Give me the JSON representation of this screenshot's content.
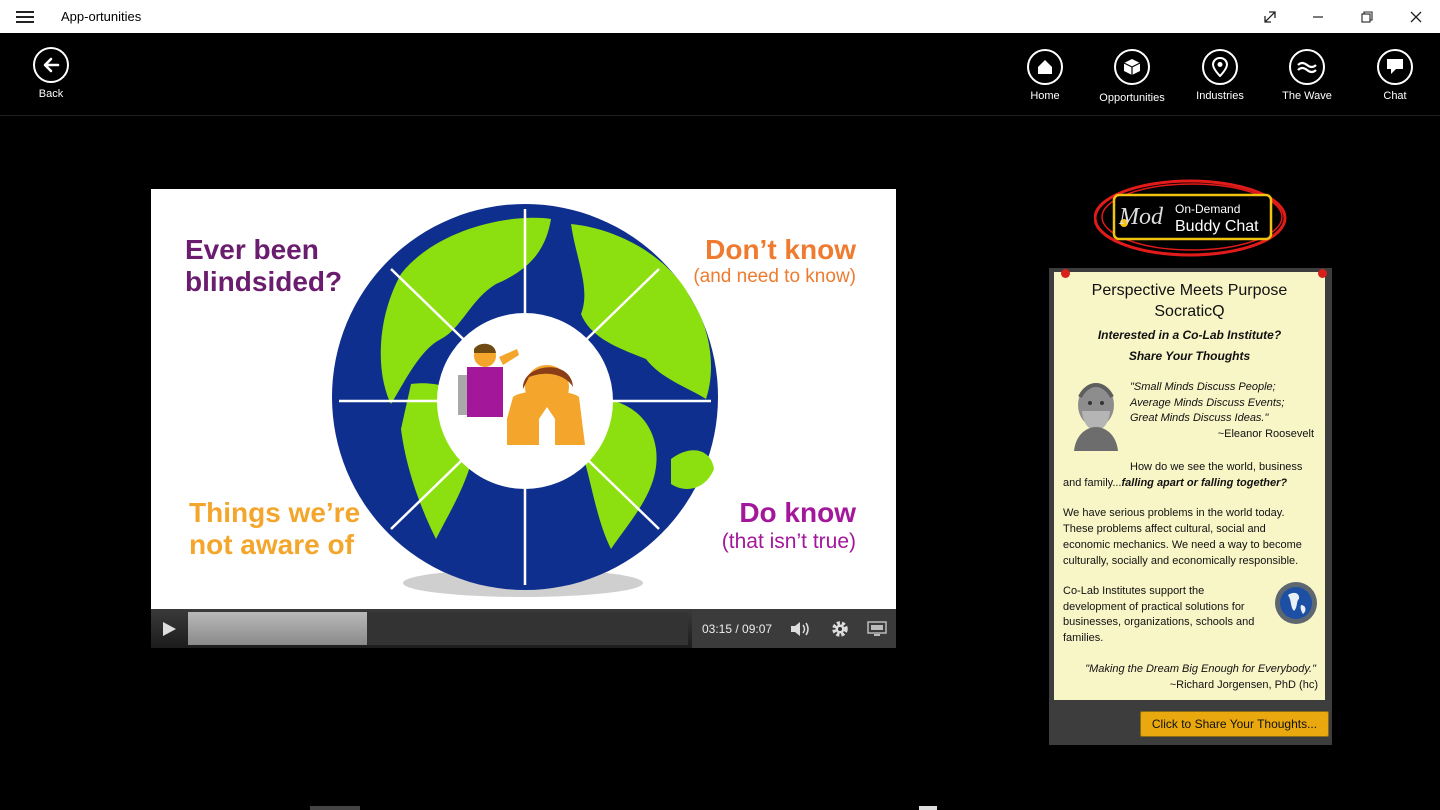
{
  "app": {
    "title": "App-ortunities"
  },
  "window_controls": {
    "expand_icon": "expand-icon",
    "minimize_icon": "minimize-icon",
    "restore_icon": "restore-icon",
    "close_icon": "close-icon"
  },
  "nav": {
    "back": "Back",
    "items": [
      {
        "label": "Home",
        "icon": "home-icon"
      },
      {
        "label": "Opportunities",
        "icon": "cube-icon"
      },
      {
        "label": "Industries",
        "icon": "location-pin-icon"
      },
      {
        "label": "The Wave",
        "icon": "wave-icon"
      },
      {
        "label": "Chat",
        "icon": "chat-bubble-icon"
      }
    ]
  },
  "video": {
    "slide": {
      "top_left": [
        "Ever been",
        "blindsided?"
      ],
      "top_right": "Don’t know",
      "top_right_sub": "(and need to know)",
      "bottom_left": [
        "Things we’re",
        "not aware of"
      ],
      "bottom_right": "Do know",
      "bottom_right_sub": "(that isn’t true)"
    },
    "time": "03:15 / 09:07",
    "progress_fraction": 0.357
  },
  "buddy_chat": {
    "brand": "Mod",
    "line1": "On-Demand",
    "line2": "Buddy Chat"
  },
  "panel": {
    "heading1": "Perspective Meets Purpose",
    "heading2": "SocraticQ",
    "subheading1": "Interested in a Co-Lab Institute?",
    "subheading2": "Share Your Thoughts",
    "quote_lines": [
      "\"Small Minds Discuss People;",
      "Average Minds Discuss Events;",
      "Great Minds Discuss Ideas.\""
    ],
    "quote_author": "~Eleanor Roosevelt",
    "para1_lines": [
      "How do we see the world, business",
      "and family..."
    ],
    "para1_emph": "falling apart or falling together?",
    "para2_lines": [
      "We have serious problems in the world today.",
      "These problems affect cultural, social and",
      "economic mechanics. We need a way to become",
      "culturally, socially and economically responsible."
    ],
    "para3_lines": [
      "Co-Lab Institutes support the",
      "development of practical solutions for",
      "businesses, organizations, schools and",
      "families."
    ],
    "closing_quote": "\"Making the Dream Big Enough for Everybody.\"",
    "closing_author": "~Richard Jorgensen, PhD (hc)",
    "button": "Click to Share Your Thoughts..."
  },
  "colors": {
    "purple": "#6a1c6e",
    "orange": "#ee7b2f",
    "amber": "#f4a62c",
    "magenta": "#a3179b",
    "ocean": "#0f2f8f",
    "land": "#8de00f",
    "red_circle": "#e11a1a"
  }
}
